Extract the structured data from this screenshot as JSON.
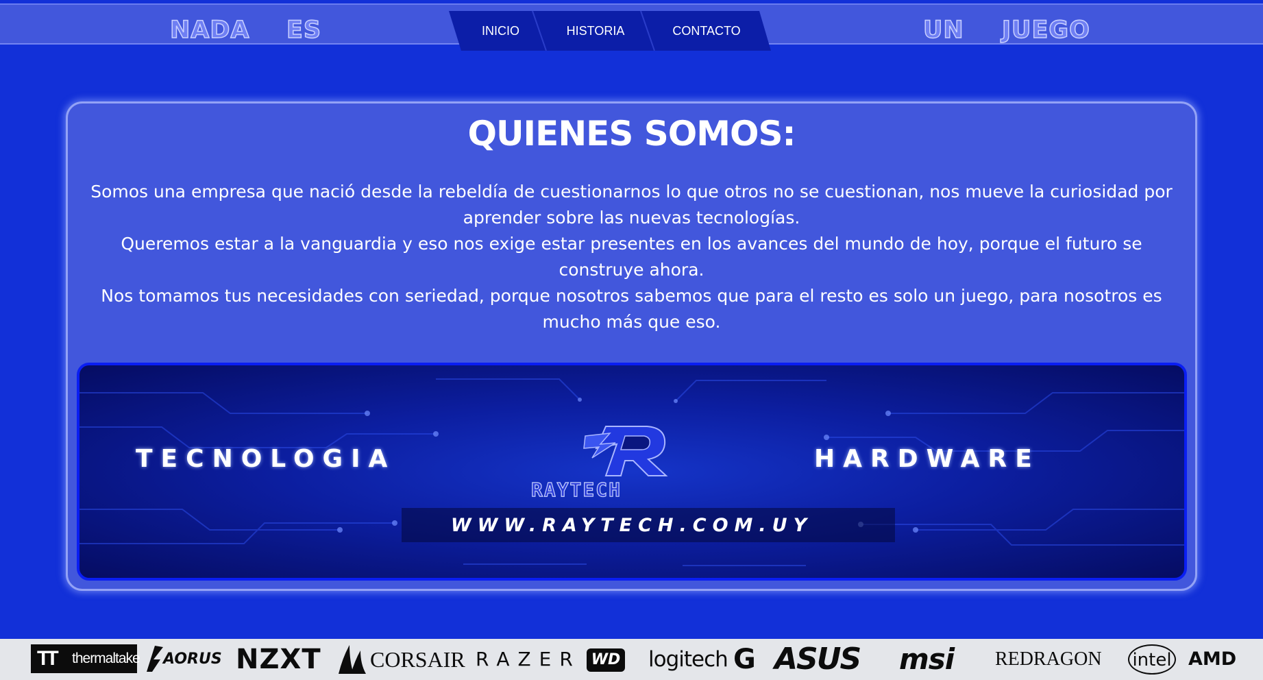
{
  "header": {
    "motto_words": [
      "NADA",
      "ES",
      "UN",
      "JUEGO"
    ],
    "nav": [
      {
        "label": "INICIO"
      },
      {
        "label": "HISTORIA"
      },
      {
        "label": "CONTACTO"
      }
    ]
  },
  "about": {
    "title": "QUIENES SOMOS:",
    "paragraphs": [
      "Somos una empresa que nació desde la rebeldía de cuestionarnos lo que otros no se cuestionan, nos mueve la curiosidad por aprender sobre las nuevas tecnologías.",
      "Queremos estar a la vanguardia y eso nos exige estar presentes en los avances del mundo de hoy, porque el futuro se construye ahora.",
      "Nos tomamos tus necesidades con seriedad, porque nosotros sabemos que para el resto es solo un juego, para nosotros es mucho más que eso."
    ]
  },
  "banner": {
    "left_text": "TECNOLOGIA",
    "right_text": "HARDWARE",
    "logo_text": "RAYTECH",
    "url": "WWW.RAYTECH.COM.UY"
  },
  "brands": [
    "thermaltake",
    "AORUS",
    "NZXT",
    "CORSAIR",
    "RAZER",
    "WD",
    "logitech",
    "G",
    "ASUS",
    "msi",
    "REDRAGON",
    "intel",
    "AMD"
  ],
  "colors": {
    "page_background": "#1230d8",
    "header_background": "#4257dc",
    "nav_background": "#0c1ea8",
    "panel_background": "#4257dc",
    "brand_strip_background": "#e4e6ea"
  }
}
